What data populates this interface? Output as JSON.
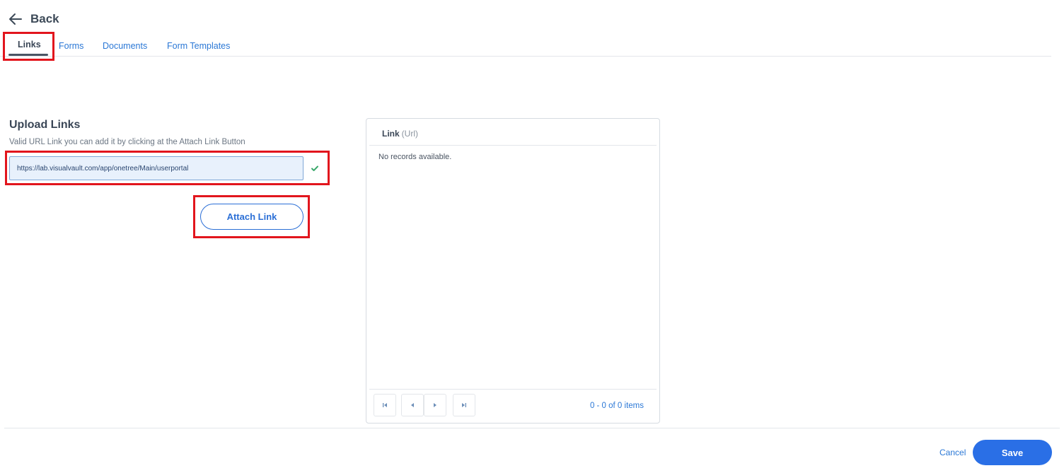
{
  "header": {
    "back_label": "Back",
    "back_icon": "arrow-left-icon"
  },
  "tabs": [
    {
      "label": "Links",
      "active": true
    },
    {
      "label": "Forms",
      "active": false
    },
    {
      "label": "Documents",
      "active": false
    },
    {
      "label": "Form Templates",
      "active": false
    }
  ],
  "upload": {
    "title": "Upload Links",
    "description": "Valid URL Link you can add it by clicking at the Attach Link Button",
    "url_value": "https://lab.visualvault.com/app/onetree/Main/userportal",
    "valid_icon": "check-icon",
    "attach_label": "Attach Link"
  },
  "grid": {
    "column_title": "Link",
    "column_subtitle": "(Url)",
    "empty_text": "No records available.",
    "pager_info": "0 - 0 of 0 items",
    "pager_icons": [
      "first-page-icon",
      "prev-page-icon",
      "next-page-icon",
      "last-page-icon"
    ]
  },
  "footer": {
    "cancel_label": "Cancel",
    "save_label": "Save"
  },
  "colors": {
    "accent": "#2a6fe6",
    "link": "#2b78d6",
    "highlight": "#e2151d",
    "valid": "#3aa86b"
  }
}
